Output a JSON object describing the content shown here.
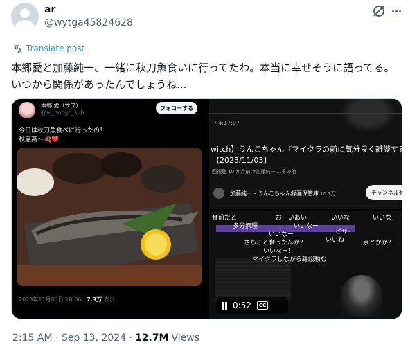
{
  "author": {
    "name": "ar",
    "handle": "@wytga45824628"
  },
  "icons": {
    "grok": "grok-icon",
    "more": "more-icon",
    "translate": "translate-icon"
  },
  "translate_label": "Translate post",
  "tweet_text": "本郷愛と加藤純一、一緒に秋刀魚食いに行ってたわ。本当に幸せそうに語ってる。いつから関係があったんでしょうね...",
  "media": {
    "left": {
      "name": "本郷 愛（サブ）",
      "handle": "@ai_hongo_sub",
      "follow_label": "フォローする",
      "text_line1": "今日は秋刀魚食べに行ったの！",
      "text_line2": "秋最高〜🍂❤️",
      "meta_date": "2023年11月03日 18:06 · ",
      "meta_views": "7.3万",
      "meta_views_suffix": " 表示"
    },
    "right_top": {
      "time": "/ 4:17:07",
      "title_line1": "witch】うんこちゃん『マイクラの前に気分良く雑談する",
      "title_line2": "【2023/11/03】",
      "meta": "回視聴  10 か月前  #加藤純一  ...その他",
      "channel": "加藤純一・うんこちゃん録画保管庫",
      "subs": "10.1万",
      "subscribe_label": "チャンネル登"
    },
    "right_bottom": {
      "comments": [
        "食前だと",
        "おーいあい",
        "いいな",
        "いいな",
        "多分無理",
        "いいなー",
        "ピザ？",
        "いいなー",
        "さちこと食ったんか？",
        "いいね",
        "京とかか？",
        "いいなー！",
        "マイクラしながら雑談頼む"
      ],
      "duration": "0:52",
      "cc_label": "CC"
    }
  },
  "footer": {
    "time": "2:15 AM · Sep 13, 2024 · ",
    "views_count": "12.7M",
    "views_label": " Views"
  }
}
